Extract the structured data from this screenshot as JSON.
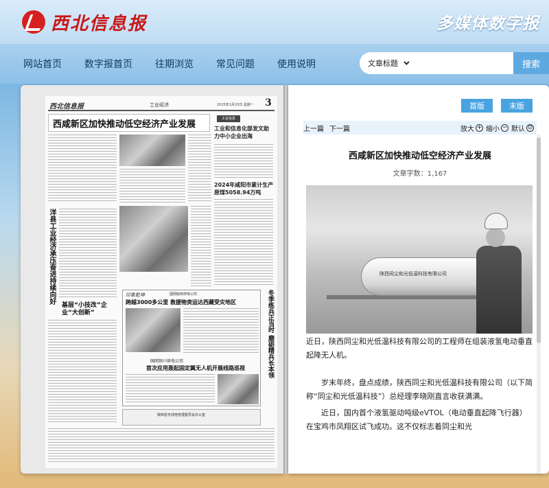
{
  "header": {
    "logo_text": "西北信息报",
    "brand_right": "多媒体数字报"
  },
  "nav": {
    "items": [
      "网站首页",
      "数字报首页",
      "往期浏览",
      "常见问题",
      "使用说明"
    ]
  },
  "search": {
    "select_value": "文章标题",
    "placeholder": "",
    "button_label": "搜索"
  },
  "paper": {
    "logo": "西北信息报",
    "section": "工业经济",
    "date": "2025年1月20日 星期一",
    "page_number": "3",
    "headline": "西咸新区加快推动低空经济产业发展",
    "side_tag": "工业信息",
    "side_title": "工业和信息化部发文助力中小企业出海",
    "side_title2": "2024年咸阳市累计生产原煤5058.94万吨",
    "vertical_title": "洋县工业经济承压奋进持续向好",
    "small_title": "基层“小技改”企业“大创新”",
    "box_logo": "印象乾坤",
    "box_pub": "国网榆林供电公司",
    "box_title1": "跨越3000多公里 救援物资运达西藏受灾地区",
    "box_pub2": "国网铜川供电公司",
    "box_title2": "首次应用轰起固定翼无人机开展线路巡视",
    "right_col": "冬季练兵正当时 磨砺精兵长本领",
    "ad_text": "陕西省无线电管理委员会办公室"
  },
  "reader": {
    "first_page": "首版",
    "last_page": "末版",
    "prev": "上一篇",
    "next": "下一篇",
    "zoom_in": "放大",
    "zoom_out": "缩小",
    "reset": "默认",
    "zoom_in_icon": "+",
    "zoom_out_icon": "−",
    "reset_icon": "⊙",
    "article_title": "西咸新区加快推动低空经济产业发展",
    "word_count": "文章字数：1,167",
    "photo_label": "陕西同尘和光低温科技有限公司",
    "caption": "近日，陕西同尘和光低温科技有限公司的工程师在组装液氢电动垂直起降无人机。",
    "para1": "岁末年终，盘点成绩，陕西同尘和光低温科技有限公司（以下简称“同尘和光低温科技”）总经理李晓刚直言收获满满。",
    "para2": "近日，国内首个液氢驱动吨级eVTOL（电动垂直起降飞行器）在宝鸡市凤翔区试飞成功。这不仅标志着同尘和光"
  },
  "colors": {
    "brand_red": "#c81818",
    "accent_blue": "#49a3e0",
    "nav_bg": "#8cc0e8"
  }
}
